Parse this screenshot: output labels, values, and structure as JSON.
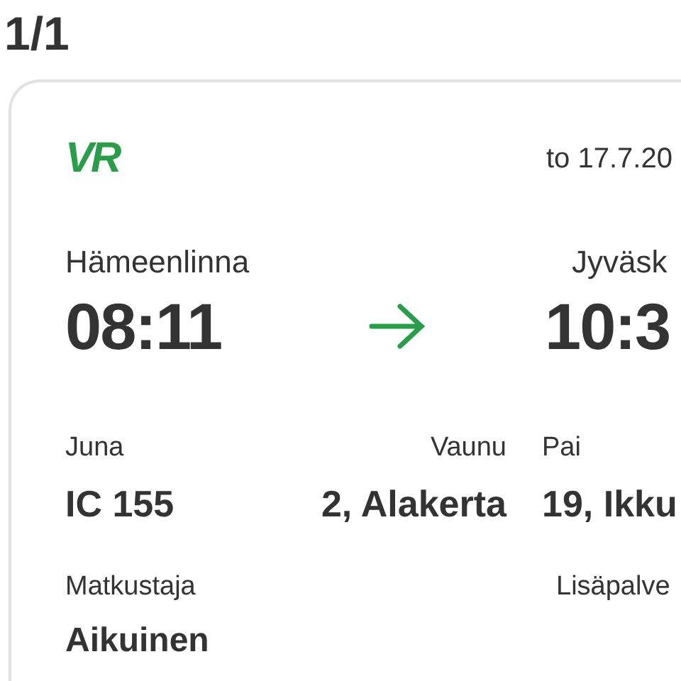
{
  "header": {
    "counter": "1/1"
  },
  "ticket": {
    "logo": "VR",
    "date": "to 17.7.20",
    "departure": {
      "station": "Hämeenlinna",
      "time": "08:11"
    },
    "arrival": {
      "station": "Jyväsk",
      "time": "10:3"
    },
    "details": [
      {
        "label": "Juna",
        "value": "IC 155"
      },
      {
        "label": "Vaunu",
        "value": "2, Alakerta"
      },
      {
        "label": "Pai",
        "value": "19, Ikku"
      }
    ],
    "extras": [
      {
        "label": "Matkustaja",
        "value": "Aikuinen"
      },
      {
        "label": "Lisäpalve"
      }
    ]
  }
}
